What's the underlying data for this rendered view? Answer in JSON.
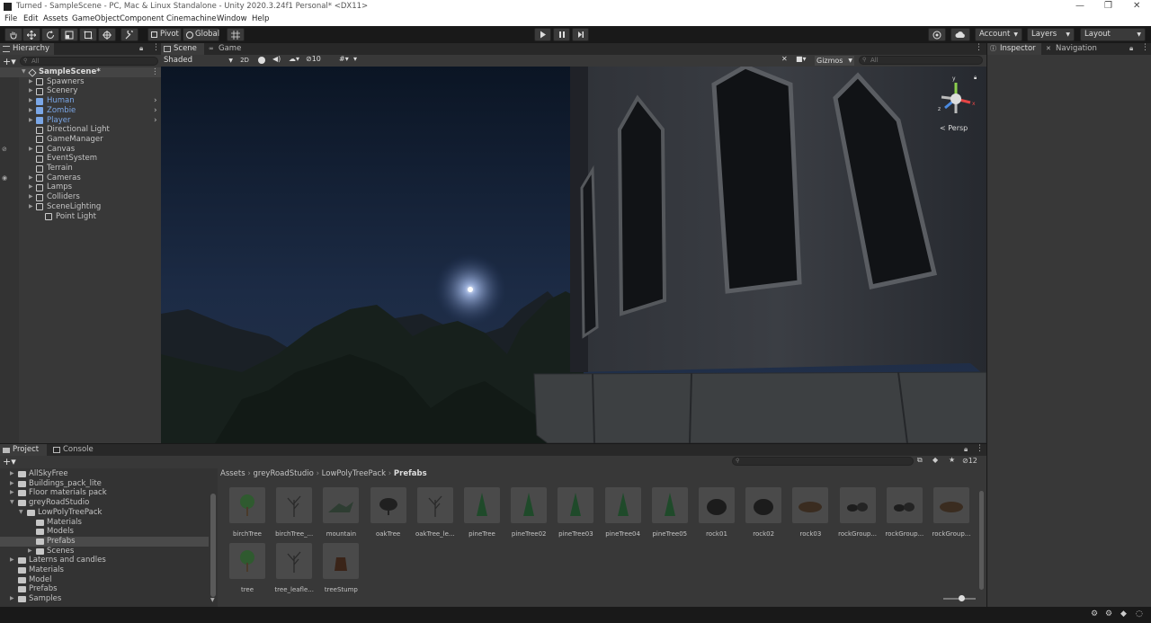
{
  "window": {
    "title": "Turned - SampleScene - PC, Mac & Linux Standalone - Unity 2020.3.24f1 Personal* <DX11>",
    "controls": [
      "—",
      "❐",
      "✕"
    ]
  },
  "menu": [
    "File",
    "Edit",
    "Assets",
    "GameObject",
    "Component",
    "Cinemachine",
    "Window",
    "Help"
  ],
  "toolbar": {
    "pivot_label": "Pivot",
    "global_label": "Global",
    "account_label": "Account",
    "layers_label": "Layers",
    "layout_label": "Layout"
  },
  "hierarchy": {
    "tab_label": "Hierarchy",
    "search_placeholder": "All",
    "scene_name": "SampleScene*",
    "items": [
      {
        "label": "Spawners",
        "expandable": true,
        "blue": false,
        "indent": 1
      },
      {
        "label": "Scenery",
        "expandable": true,
        "blue": false,
        "indent": 1
      },
      {
        "label": "Human",
        "expandable": true,
        "blue": true,
        "indent": 1
      },
      {
        "label": "Zombie",
        "expandable": true,
        "blue": true,
        "indent": 1
      },
      {
        "label": "Player",
        "expandable": true,
        "blue": true,
        "indent": 1
      },
      {
        "label": "Directional Light",
        "expandable": false,
        "blue": false,
        "indent": 1
      },
      {
        "label": "GameManager",
        "expandable": false,
        "blue": false,
        "indent": 1
      },
      {
        "label": "Canvas",
        "expandable": true,
        "blue": false,
        "indent": 1
      },
      {
        "label": "EventSystem",
        "expandable": false,
        "blue": false,
        "indent": 1
      },
      {
        "label": "Terrain",
        "expandable": false,
        "blue": false,
        "indent": 1
      },
      {
        "label": "Cameras",
        "expandable": true,
        "blue": false,
        "indent": 1
      },
      {
        "label": "Lamps",
        "expandable": true,
        "blue": false,
        "indent": 1
      },
      {
        "label": "Colliders",
        "expandable": true,
        "blue": false,
        "indent": 1
      },
      {
        "label": "SceneLighting",
        "expandable": true,
        "blue": false,
        "indent": 1
      },
      {
        "label": "Point Light",
        "expandable": false,
        "blue": false,
        "indent": 2
      }
    ]
  },
  "scene": {
    "tab_scene": "Scene",
    "tab_game": "Game",
    "shading_mode": "Shaded",
    "mode_2d": "2D",
    "hidden_count": "10",
    "gizmos_label": "Gizmos",
    "search_placeholder": "All",
    "persp_label": "Persp",
    "axis_y": "y",
    "axis_x": "x",
    "axis_z": "z"
  },
  "inspector": {
    "tab_inspector": "Inspector",
    "tab_navigation": "Navigation"
  },
  "project": {
    "tab_project": "Project",
    "tab_console": "Console",
    "breadcrumb": [
      "Assets",
      "greyRoadStudio",
      "LowPolyTreePack",
      "Prefabs"
    ],
    "hidden_count": "12",
    "tree": [
      {
        "label": "AllSkyFree",
        "indent": 0,
        "arrow": "▶"
      },
      {
        "label": "Buildings_pack_lite",
        "indent": 0,
        "arrow": "▶"
      },
      {
        "label": "Floor materials pack",
        "indent": 0,
        "arrow": "▶"
      },
      {
        "label": "greyRoadStudio",
        "indent": 0,
        "arrow": "▼"
      },
      {
        "label": "LowPolyTreePack",
        "indent": 1,
        "arrow": "▼"
      },
      {
        "label": "Materials",
        "indent": 2,
        "arrow": ""
      },
      {
        "label": "Models",
        "indent": 2,
        "arrow": ""
      },
      {
        "label": "Prefabs",
        "indent": 2,
        "arrow": "",
        "selected": true
      },
      {
        "label": "Scenes",
        "indent": 2,
        "arrow": "▶"
      },
      {
        "label": "Laterns and candles",
        "indent": 0,
        "arrow": "▶"
      },
      {
        "label": "Materials",
        "indent": 0,
        "arrow": ""
      },
      {
        "label": "Model",
        "indent": 0,
        "arrow": ""
      },
      {
        "label": "Prefabs",
        "indent": 0,
        "arrow": ""
      },
      {
        "label": "Samples",
        "indent": 0,
        "arrow": "▶"
      }
    ],
    "assets": [
      {
        "label": "birchTree",
        "kind": "tree"
      },
      {
        "label": "birchTree_...",
        "kind": "bare"
      },
      {
        "label": "mountain",
        "kind": "mountain"
      },
      {
        "label": "oakTree",
        "kind": "oak"
      },
      {
        "label": "oakTree_le...",
        "kind": "bare"
      },
      {
        "label": "pineTree",
        "kind": "pine"
      },
      {
        "label": "pineTree02",
        "kind": "pine"
      },
      {
        "label": "pineTree03",
        "kind": "pine"
      },
      {
        "label": "pineTree04",
        "kind": "pine"
      },
      {
        "label": "pineTree05",
        "kind": "pine"
      },
      {
        "label": "rock01",
        "kind": "rock"
      },
      {
        "label": "rock02",
        "kind": "rock"
      },
      {
        "label": "rock03",
        "kind": "flatrock"
      },
      {
        "label": "rockGroup...",
        "kind": "rocks"
      },
      {
        "label": "rockGroup...",
        "kind": "rocks"
      },
      {
        "label": "rockGroup...",
        "kind": "flatrock"
      },
      {
        "label": "tree",
        "kind": "tree"
      },
      {
        "label": "tree_leafle...",
        "kind": "bare"
      },
      {
        "label": "treeStump",
        "kind": "stump"
      }
    ]
  }
}
